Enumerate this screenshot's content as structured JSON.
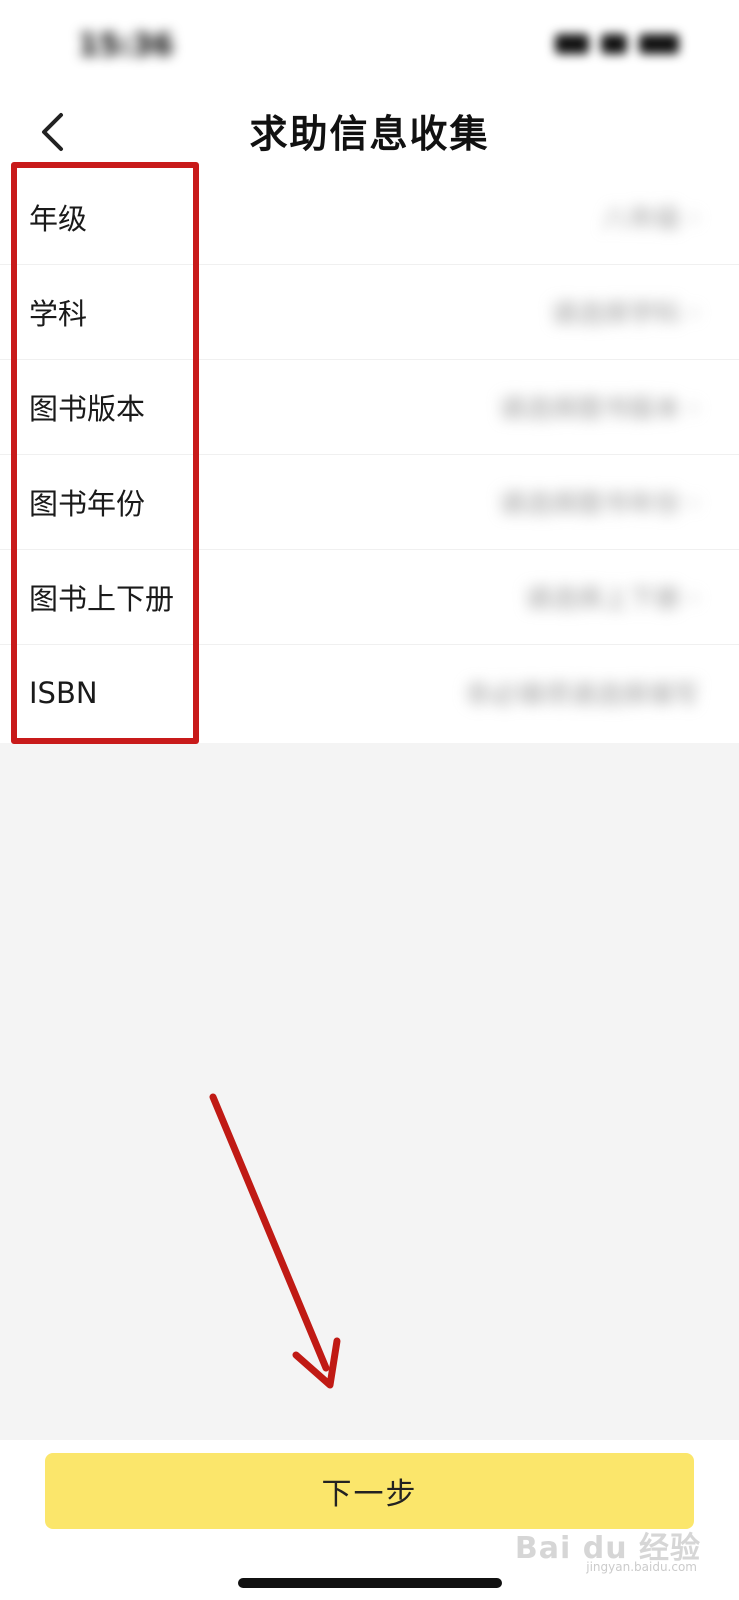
{
  "status_bar": {
    "time": "15:36"
  },
  "nav": {
    "title": "求助信息收集",
    "back_icon": "chevron-left-icon"
  },
  "form": {
    "rows": [
      {
        "label": "年级",
        "value": "八年级"
      },
      {
        "label": "学科",
        "value": "请选择学科"
      },
      {
        "label": "图书版本",
        "value": "请选择图书版本"
      },
      {
        "label": "图书年份",
        "value": "请选择图书年份"
      },
      {
        "label": "图书上下册",
        "value": "请选择上下册"
      },
      {
        "label": "ISBN",
        "value": "非必填项请选择填写"
      }
    ]
  },
  "footer": {
    "next_label": "下一步"
  },
  "watermark": {
    "brand": "Bai du 经验",
    "url": "jingyan.baidu.com"
  },
  "colors": {
    "accent_button": "#fbe66b",
    "annotation_red": "#c81a1a",
    "background": "#f4f4f4"
  }
}
